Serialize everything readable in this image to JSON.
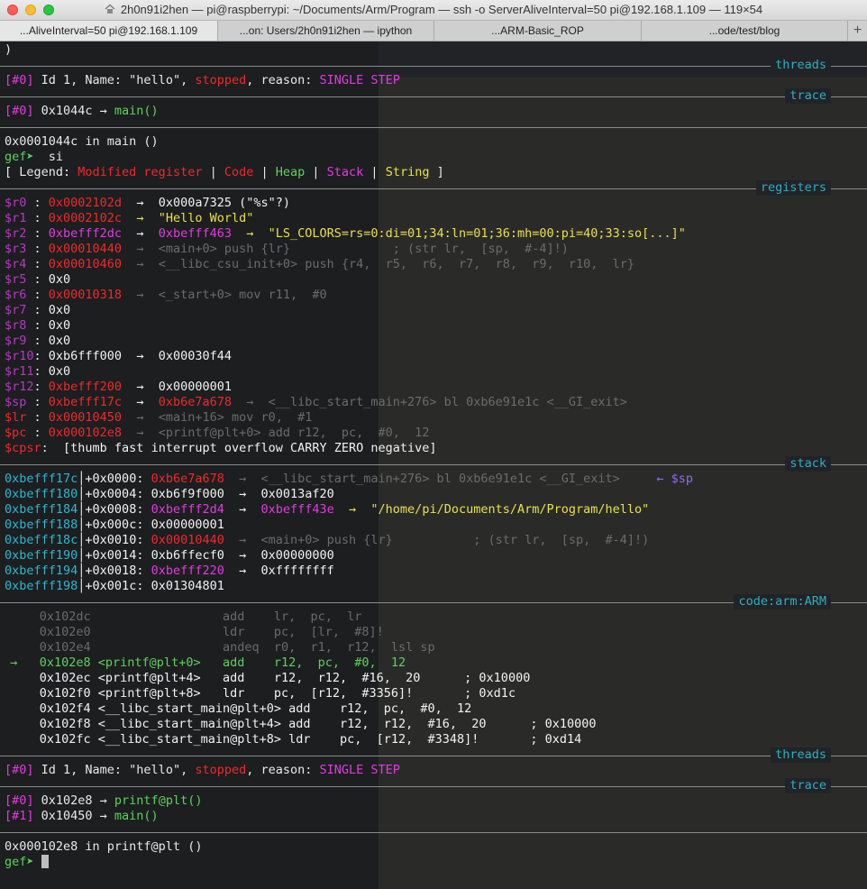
{
  "window": {
    "title": "2h0n91i2hen — pi@raspberrypi: ~/Documents/Arm/Program — ssh -o ServerAliveInterval=50 pi@192.168.1.109 — 119×54"
  },
  "tabs": [
    {
      "label": "...AliveInterval=50 pi@192.168.1.109",
      "active": true
    },
    {
      "label": "...on: Users/2h0n91i2hen — ipython",
      "active": false
    },
    {
      "label": "...ARM-Basic_ROP",
      "active": false
    },
    {
      "label": "...ode/test/blog",
      "active": false
    }
  ],
  "tab_add": "+",
  "terminal": {
    "paren": ")",
    "sections": {
      "threads": "threads",
      "trace": "trace",
      "registers": "registers",
      "stack": "stack",
      "code": "code:arm:ARM"
    },
    "thread1": {
      "idx": "[#0]",
      "id": " Id 1, Name: \"hello\", ",
      "state": "stopped",
      "reason_label": ", reason: ",
      "reason": "SINGLE STEP"
    },
    "trace1": {
      "idx": "[#0]",
      "addr": " 0x1044c → ",
      "fn": "main()"
    },
    "frame_line": "0x0001044c in main ()",
    "prompt": "gef➤",
    "cmd": "  si",
    "legend": {
      "open": "[ Legend: ",
      "modified": "Modified register",
      "code": "Code",
      "heap": "Heap",
      "stack": "Stack",
      "string": "String",
      "close": " ]",
      "bar": " | "
    },
    "registers": [
      {
        "name": "$r0 ",
        "val": "0x0002102d",
        "rest": "  →  0x000a7325 (\"%s\"?)",
        "rest_color": "white"
      },
      {
        "name": "$r1 ",
        "val": "0x0002102c",
        "rest": "  →  \"Hello World\"",
        "rest_color": "yel"
      },
      {
        "name": "$r2 ",
        "val": "0xbefff2dc",
        "arrow": "  →  ",
        "ptr": "0xbefff463",
        "rest": "  →  \"LS_COLORS=rs=0:di=01;34:ln=01;36:mh=00:pi=40;33:so[...]\"",
        "rest_color": "yel"
      },
      {
        "name": "$r3 ",
        "val": "0x00010440",
        "rest": "  →  <main+0> push {lr}              ; (str lr,  [sp,  #-4]!)",
        "rest_color": "grey"
      },
      {
        "name": "$r4 ",
        "val": "0x00010460",
        "rest": "  →  <__libc_csu_init+0> push {r4,  r5,  r6,  r7,  r8,  r9,  r10,  lr}",
        "rest_color": "grey"
      },
      {
        "name": "$r5 ",
        "plain": "0x0"
      },
      {
        "name": "$r6 ",
        "val": "0x00010318",
        "rest": "  →  <_start+0> mov r11,  #0",
        "rest_color": "grey"
      },
      {
        "name": "$r7 ",
        "plain": "0x0"
      },
      {
        "name": "$r8 ",
        "plain": "0x0"
      },
      {
        "name": "$r9 ",
        "plain": "0x0"
      },
      {
        "name": "$r10",
        "plain": "0xb6fff000  →  0x00030f44"
      },
      {
        "name": "$r11",
        "plain": "0x0"
      },
      {
        "name": "$r12",
        "val": "0xbefff200",
        "rest": "  →  0x00000001",
        "rest_color": "white"
      },
      {
        "name": "$sp ",
        "val": "0xbefff17c",
        "arrow": "  →  ",
        "ptr": "0xb6e7a678",
        "ptr_color": "red",
        "rest": "  →  <__libc_start_main+276> bl 0xb6e91e1c <__GI_exit>",
        "rest_color": "grey"
      },
      {
        "name": "$lr ",
        "val": "0x00010450",
        "rest": "  →  <main+16> mov r0,  #1",
        "rest_color": "grey"
      },
      {
        "name": "$pc ",
        "val": "0x000102e8",
        "rest": "  →  <printf@plt+0> add r12,  pc,  #0,  12",
        "rest_color": "grey"
      },
      {
        "name": "$cpsr",
        "flags_pre": " [thumb fast interrupt overflow ",
        "flags_hl": "CARRY ZERO",
        "flags_post": " negative]"
      }
    ],
    "stack": [
      {
        "addr": "0xbefff17c",
        "off": "+0x0000: ",
        "val": "0xb6e7a678",
        "val_color": "red",
        "rest": "  →  <__libc_start_main+276> bl 0xb6e91e1c <__GI_exit>",
        "rest_color": "grey",
        "tag": "     ← $sp"
      },
      {
        "addr": "0xbefff180",
        "off": "+0x0004: ",
        "val": "0xb6f9f000",
        "val_color": "white",
        "rest": "  →  0x0013af20",
        "rest_color": "white"
      },
      {
        "addr": "0xbefff184",
        "off": "+0x0008: ",
        "val": "0xbefff2d4",
        "val_color": "mag",
        "arrow": "  →  ",
        "ptr": "0xbefff43e",
        "rest": "  →  \"/home/pi/Documents/Arm/Program/hello\"",
        "rest_color": "yel"
      },
      {
        "addr": "0xbefff188",
        "off": "+0x000c: ",
        "val": "0x00000001",
        "val_color": "white"
      },
      {
        "addr": "0xbefff18c",
        "off": "+0x0010: ",
        "val": "0x00010440",
        "val_color": "red",
        "rest": "  →  <main+0> push {lr}           ; (str lr,  [sp,  #-4]!)",
        "rest_color": "grey"
      },
      {
        "addr": "0xbefff190",
        "off": "+0x0014: ",
        "val": "0xb6ffecf0",
        "val_color": "white",
        "rest": "  →  0x00000000",
        "rest_color": "white"
      },
      {
        "addr": "0xbefff194",
        "off": "+0x0018: ",
        "val": "0xbefff220",
        "val_color": "mag",
        "rest": "  →  0xffffffff",
        "rest_color": "white"
      },
      {
        "addr": "0xbefff198",
        "off": "+0x001c: ",
        "val": "0x01304801",
        "val_color": "white"
      }
    ],
    "code": [
      {
        "text": "      0x102dc                  add    lr,  pc,  lr",
        "color": "grey"
      },
      {
        "text": "      0x102e0                  ldr    pc,  [lr,  #8]!",
        "color": "grey"
      },
      {
        "text": "      0x102e4                  andeq  r0,  r1,  r12,  lsl sp",
        "color": "grey"
      },
      {
        "text": "  →   0x102e8 <printf@plt+0>   add    r12,  pc,  #0,  12",
        "color": "bgreen"
      },
      {
        "text": "      0x102ec <printf@plt+4>   add    r12,  r12,  #16,  20      ; 0x10000",
        "color": "white"
      },
      {
        "text": "      0x102f0 <printf@plt+8>   ldr    pc,  [r12,  #3356]!       ; 0xd1c",
        "color": "white"
      },
      {
        "text": "      0x102f4 <__libc_start_main@plt+0> add    r12,  pc,  #0,  12",
        "color": "white"
      },
      {
        "text": "      0x102f8 <__libc_start_main@plt+4> add    r12,  r12,  #16,  20      ; 0x10000",
        "color": "white"
      },
      {
        "text": "      0x102fc <__libc_start_main@plt+8> ldr    pc,  [r12,  #3348]!       ; 0xd14",
        "color": "white"
      }
    ],
    "thread2": {
      "idx": "[#0]",
      "id": " Id 1, Name: \"hello\", ",
      "state": "stopped",
      "reason_label": ", reason: ",
      "reason": "SINGLE STEP"
    },
    "trace2": [
      {
        "idx": "[#0]",
        "addr": " 0x102e8 → ",
        "fn": "printf@plt()"
      },
      {
        "idx": "[#1]",
        "addr": " 0x10450 → ",
        "fn": "main()"
      }
    ],
    "frame_line2": "0x000102e8 in printf@plt ()",
    "prompt2": "gef➤"
  }
}
